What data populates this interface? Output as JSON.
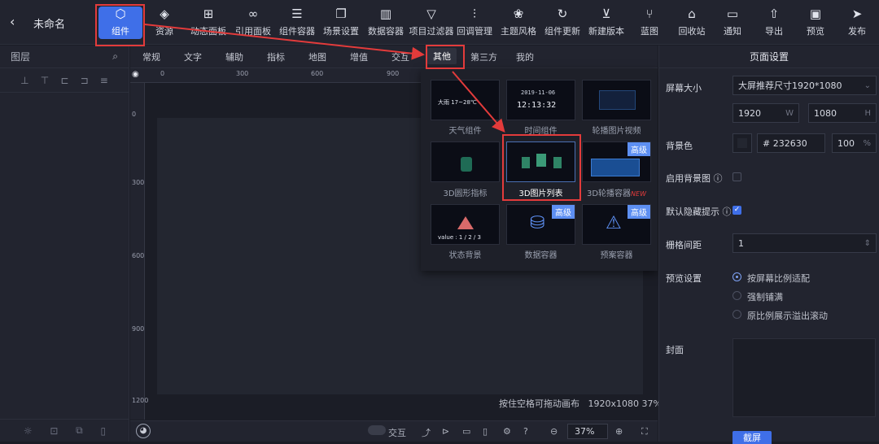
{
  "header": {
    "back": "‹",
    "title": "未命名"
  },
  "toolbar": [
    {
      "label": "组件",
      "icon": "component-icon",
      "glyph": "⬡",
      "active": true
    },
    {
      "label": "资源",
      "icon": "layers-icon",
      "glyph": "◈"
    },
    {
      "label": "动态面板",
      "icon": "grid-icon",
      "glyph": "⊞"
    },
    {
      "label": "引用面板",
      "icon": "link-icon",
      "glyph": "∞"
    },
    {
      "label": "组件容器",
      "icon": "container-icon",
      "glyph": "☰"
    },
    {
      "label": "场景设置",
      "icon": "copy-icon",
      "glyph": "❐"
    },
    {
      "label": "数据容器",
      "icon": "chart-icon",
      "glyph": "▥"
    },
    {
      "label": "项目过滤器",
      "icon": "filter-icon",
      "glyph": "▽"
    },
    {
      "label": "回调管理",
      "icon": "sliders-icon",
      "glyph": "⫶"
    },
    {
      "label": "主题风格",
      "icon": "theme-icon",
      "glyph": "❀"
    },
    {
      "label": "组件更新",
      "icon": "refresh-icon",
      "glyph": "↻"
    },
    {
      "label": "新建版本",
      "icon": "version-icon",
      "glyph": "⊻"
    },
    {
      "label": "蓝图",
      "icon": "blueprint-icon",
      "glyph": "⑂"
    },
    {
      "label": "回收站",
      "icon": "trash-icon",
      "glyph": "⌂"
    },
    {
      "label": "通知",
      "icon": "message-icon",
      "glyph": "▭"
    },
    {
      "label": "导出",
      "icon": "export-icon",
      "glyph": "⇧"
    },
    {
      "label": "预览",
      "icon": "preview-icon",
      "glyph": "▣"
    },
    {
      "label": "发布",
      "icon": "send-icon",
      "glyph": "➤"
    }
  ],
  "left_panel": {
    "title": "图层",
    "tools": [
      "⊥",
      "⊤",
      "⊏",
      "⊐",
      "≡"
    ],
    "footer": [
      "☼",
      "⊡",
      "⧉",
      "▯"
    ]
  },
  "category_tabs": [
    {
      "label": "常规"
    },
    {
      "label": "文字"
    },
    {
      "label": "辅助"
    },
    {
      "label": "指标"
    },
    {
      "label": "地图"
    },
    {
      "label": "增值"
    },
    {
      "label": "交互"
    },
    {
      "label": "其他",
      "active": true
    },
    {
      "label": "第三方"
    },
    {
      "label": "我的"
    }
  ],
  "components": [
    {
      "label": "天气组件",
      "preview": "大雨  17~28℃"
    },
    {
      "label": "时间组件",
      "preview_date": "2019-11-06",
      "preview_time": "12:13:32"
    },
    {
      "label": "轮播图片视频"
    },
    {
      "label": "3D圆形指标"
    },
    {
      "label": "3D图片列表"
    },
    {
      "label": "3D轮播容器",
      "badge": "高级",
      "flag": "NEW"
    },
    {
      "label": "状态背景",
      "preview": "value : 1 / 2 / 3"
    },
    {
      "label": "数据容器",
      "badge": "高级"
    },
    {
      "label": "预案容器",
      "badge": "高级"
    }
  ],
  "rulers": {
    "h": [
      "0",
      "300",
      "600",
      "900"
    ],
    "v": [
      "0",
      "300",
      "600",
      "900",
      "1200"
    ]
  },
  "canvas": {
    "hint": "按住空格可拖动画布",
    "size": "1920x1080",
    "zoom": "37%"
  },
  "bottom_bar": {
    "interact_label": "交互",
    "zoom": "37%",
    "zoom_out": "⊖",
    "zoom_in": "⊕"
  },
  "right_panel": {
    "title": "页面设置",
    "screen_size_label": "屏幕大小",
    "screen_size_value": "大屏推荐尺寸1920*1080",
    "width": "1920",
    "width_unit": "W",
    "height": "1080",
    "height_unit": "H",
    "bg_label": "背景色",
    "bg_color": "# 232630",
    "bg_opacity": "100",
    "bg_opacity_unit": "%",
    "bg_image_label": "启用背景图 ⓘ",
    "hide_tip_label": "默认隐藏提示 ⓘ",
    "grid_label": "栅格间距",
    "grid_value": "1",
    "preview_label": "预览设置",
    "preview_options": [
      "按屏幕比例适配",
      "强制铺满",
      "原比例展示溢出滚动"
    ],
    "cover_label": "封面",
    "save": "截屏"
  },
  "colors": {
    "accent": "#3f6fe8",
    "highlight": "#e33b3b",
    "bg": "#1b1d26"
  }
}
